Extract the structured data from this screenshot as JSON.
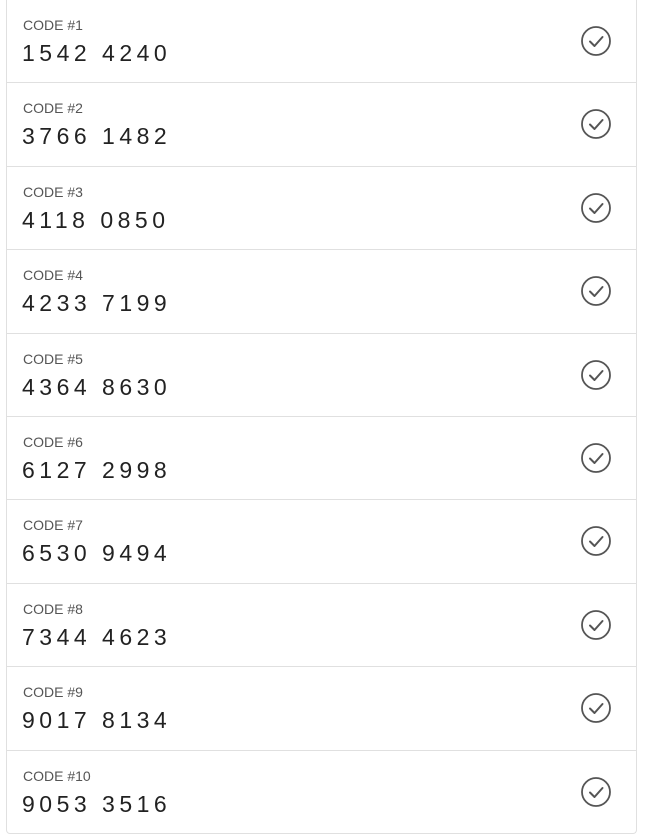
{
  "codes": [
    {
      "label": "CODE #1",
      "value": "1542 4240",
      "status_icon": "check-circle-icon"
    },
    {
      "label": "CODE #2",
      "value": "3766 1482",
      "status_icon": "check-circle-icon"
    },
    {
      "label": "CODE #3",
      "value": "4118 0850",
      "status_icon": "check-circle-icon"
    },
    {
      "label": "CODE #4",
      "value": "4233 7199",
      "status_icon": "check-circle-icon"
    },
    {
      "label": "CODE #5",
      "value": "4364 8630",
      "status_icon": "check-circle-icon"
    },
    {
      "label": "CODE #6",
      "value": "6127 2998",
      "status_icon": "check-circle-icon"
    },
    {
      "label": "CODE #7",
      "value": "6530 9494",
      "status_icon": "check-circle-icon"
    },
    {
      "label": "CODE #8",
      "value": "7344 4623",
      "status_icon": "check-circle-icon"
    },
    {
      "label": "CODE #9",
      "value": "9017 8134",
      "status_icon": "check-circle-icon"
    },
    {
      "label": "CODE #10",
      "value": "9053 3516",
      "status_icon": "check-circle-icon"
    }
  ],
  "colors": {
    "border": "#e0e0e0",
    "label": "#555555",
    "value": "#222222",
    "icon": "#555555"
  }
}
